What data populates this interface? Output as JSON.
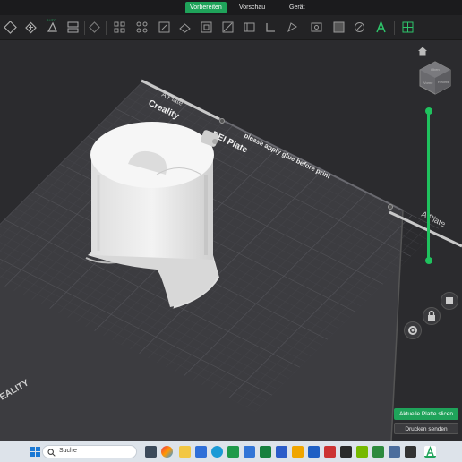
{
  "topbar": {
    "tabs": [
      {
        "label": "Vorbereiten",
        "active": true
      },
      {
        "label": "Vorschau",
        "active": false
      },
      {
        "label": "Gerät",
        "active": false
      }
    ]
  },
  "toolbar": {
    "auto_label": "AUTO",
    "icons": [
      "add-object-icon",
      "add-plate-icon",
      "auto-orient-icon",
      "arrange-icon",
      "split-icon",
      "layout-grid-icon",
      "scale-icon",
      "move-icon",
      "rotate-icon",
      "cut-icon",
      "seam-icon",
      "support-paint-icon",
      "color-paint-icon",
      "measure-icon",
      "text-icon",
      "assembly-icon"
    ]
  },
  "plate": {
    "brand": "Creality",
    "surface": "PEI Plate",
    "notice": "please apply glue before print",
    "top_label": "A Plate",
    "side_label": "A Plate",
    "corner_brand": "EALITY"
  },
  "view_cube": {
    "top": "Oben",
    "front": "Vorne",
    "right": "Rechts"
  },
  "layer_slider": {
    "top_fraction": 1.0,
    "bottom_fraction": 0.0,
    "color": "#1fc25e"
  },
  "actions": {
    "slice_label": "Aktuelle Platte slicen",
    "send_label": "Drucken senden"
  },
  "taskbar": {
    "search_placeholder": "Suche"
  },
  "colors": {
    "accent": "#1fa35a",
    "plate": "#3e3e42",
    "model": "#e9e9ea"
  }
}
